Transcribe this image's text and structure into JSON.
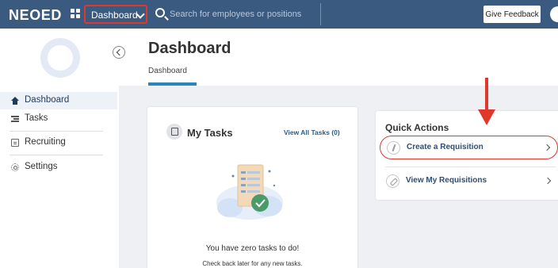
{
  "topbar": {
    "logo": "NEOED",
    "module_selector": "Dashboard",
    "search_placeholder": "Search for employees or positions",
    "feedback_label": "Give Feedback"
  },
  "sidebar": {
    "items": [
      {
        "label": "Dashboard",
        "icon": "home-icon",
        "active": true
      },
      {
        "label": "Tasks",
        "icon": "tasks-icon",
        "active": false
      },
      {
        "label": "Recruiting",
        "icon": "document-icon",
        "active": false
      },
      {
        "label": "Settings",
        "icon": "gear-icon",
        "active": false
      }
    ]
  },
  "header": {
    "title": "Dashboard",
    "breadcrumb": "Dashboard"
  },
  "my_tasks": {
    "title": "My Tasks",
    "view_all": "View All Tasks (0)",
    "empty_title": "You have zero tasks to do!",
    "empty_subtitle": "Check back later for any new tasks."
  },
  "quick_actions": {
    "title": "Quick Actions",
    "items": [
      {
        "label": "Create a Requisition",
        "icon": "bolt-icon",
        "highlighted": true
      },
      {
        "label": "View My Requisitions",
        "icon": "link-icon",
        "highlighted": false
      }
    ]
  },
  "colors": {
    "topbar": "#3a5a80",
    "accent": "#2a86b8",
    "highlight": "#e0392b",
    "content_bg": "#eef0f4"
  }
}
